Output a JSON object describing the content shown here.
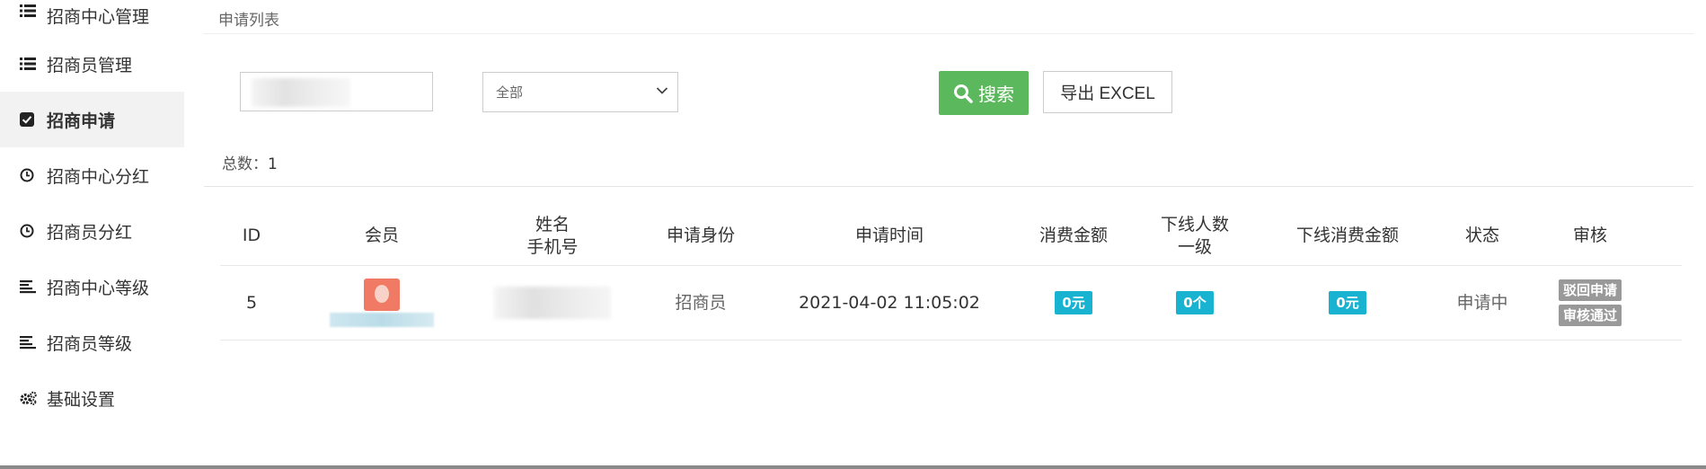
{
  "sidebar": {
    "items": [
      {
        "label": "招商中心管理",
        "icon": "list-icon"
      },
      {
        "label": "招商员管理",
        "icon": "list-icon"
      },
      {
        "label": "招商申请",
        "icon": "checkbox-icon",
        "active": true
      },
      {
        "label": "招商中心分红",
        "icon": "clock-icon"
      },
      {
        "label": "招商员分红",
        "icon": "clock-icon"
      },
      {
        "label": "招商中心等级",
        "icon": "align-left-icon"
      },
      {
        "label": "招商员等级",
        "icon": "align-left-icon"
      },
      {
        "label": "基础设置",
        "icon": "gears-icon"
      }
    ]
  },
  "main": {
    "title": "申请列表",
    "filter": {
      "select_value": "全部",
      "search_label": "搜索",
      "export_label": "导出 EXCEL"
    },
    "total_label": "总数：",
    "total_value": "1",
    "table": {
      "headers": {
        "id": "ID",
        "member": "会员",
        "name": "姓名",
        "phone": "手机号",
        "role": "申请身份",
        "time": "申请时间",
        "spend": "消费金额",
        "downline": "下线人数",
        "downline_level": "一级",
        "downline_spend": "下线消费金额",
        "status": "状态",
        "audit": "审核"
      },
      "rows": [
        {
          "id": "5",
          "role": "招商员",
          "time": "2021-04-02 11:05:02",
          "spend": "0元",
          "downline": "0个",
          "downline_spend": "0元",
          "status": "申请中",
          "reject_label": "驳回申请",
          "approve_label": "审核通过"
        }
      ]
    }
  },
  "colors": {
    "primary_green": "#5cb85c",
    "badge_cyan": "#17b3d1",
    "audit_gray": "#999999"
  }
}
